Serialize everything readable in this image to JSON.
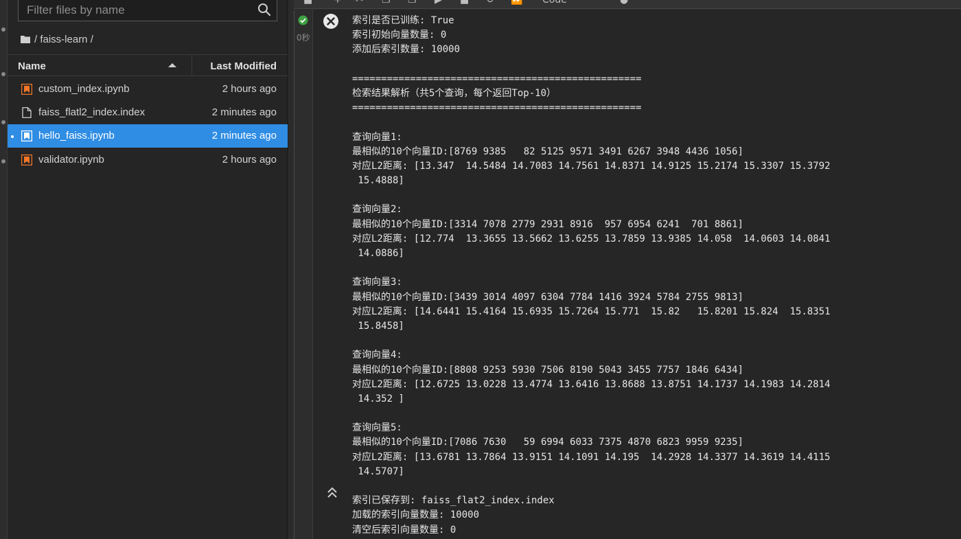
{
  "file_browser": {
    "filter_placeholder": "Filter files by name",
    "breadcrumb": "/ faiss-learn /",
    "columns": {
      "name": "Name",
      "modified": "Last Modified"
    },
    "files": [
      {
        "name": "custom_index.ipynb",
        "modified": "2 hours ago",
        "icon": "notebook-icon"
      },
      {
        "name": "faiss_flatl2_index.index",
        "modified": "2 minutes ago",
        "icon": "file-icon"
      },
      {
        "name": "hello_faiss.ipynb",
        "modified": "2 minutes ago",
        "icon": "notebook-icon"
      },
      {
        "name": "validator.ipynb",
        "modified": "2 hours ago",
        "icon": "notebook-icon"
      }
    ]
  },
  "notebook": {
    "toolbar_cell_type": "Code",
    "exec_time": "0秒",
    "output_lines": [
      "索引是否已训练: True",
      "索引初始向量数量: 0",
      "添加后索引数量: 10000",
      "",
      "==================================================",
      "检索结果解析（共5个查询，每个返回Top-10）",
      "==================================================",
      "",
      "查询向量1:",
      "最相似的10个向量ID:[8769 9385   82 5125 9571 3491 6267 3948 4436 1056]",
      "对应L2距离: [13.347  14.5484 14.7083 14.7561 14.8371 14.9125 15.2174 15.3307 15.3792",
      " 15.4888]",
      "",
      "查询向量2:",
      "最相似的10个向量ID:[3314 7078 2779 2931 8916  957 6954 6241  701 8861]",
      "对应L2距离: [12.774  13.3655 13.5662 13.6255 13.7859 13.9385 14.058  14.0603 14.0841",
      " 14.0886]",
      "",
      "查询向量3:",
      "最相似的10个向量ID:[3439 3014 4097 6304 7784 1416 3924 5784 2755 9813]",
      "对应L2距离: [14.6441 15.4164 15.6935 15.7264 15.771  15.82   15.8201 15.824  15.8351",
      " 15.8458]",
      "",
      "查询向量4:",
      "最相似的10个向量ID:[8808 9253 5930 7506 8190 5043 3455 7757 1846 6434]",
      "对应L2距离: [12.6725 13.0228 13.4774 13.6416 13.8688 13.8751 14.1737 14.1983 14.2814",
      " 14.352 ]",
      "",
      "查询向量5:",
      "最相似的10个向量ID:[7086 7630   59 6994 6033 7375 4870 6823 9959 9235]",
      "对应L2距离: [13.6781 13.7864 13.9151 14.1091 14.195  14.2928 14.3377 14.3619 14.4115",
      " 14.5707]",
      "",
      "索引已保存到: faiss_flat2_index.index",
      "加载的索引向量数量: 10000",
      "清空后索引向量数量: 0"
    ]
  },
  "colors": {
    "selection": "#2f8de4",
    "notebook_icon": "#f37726",
    "success": "#3fa142"
  }
}
